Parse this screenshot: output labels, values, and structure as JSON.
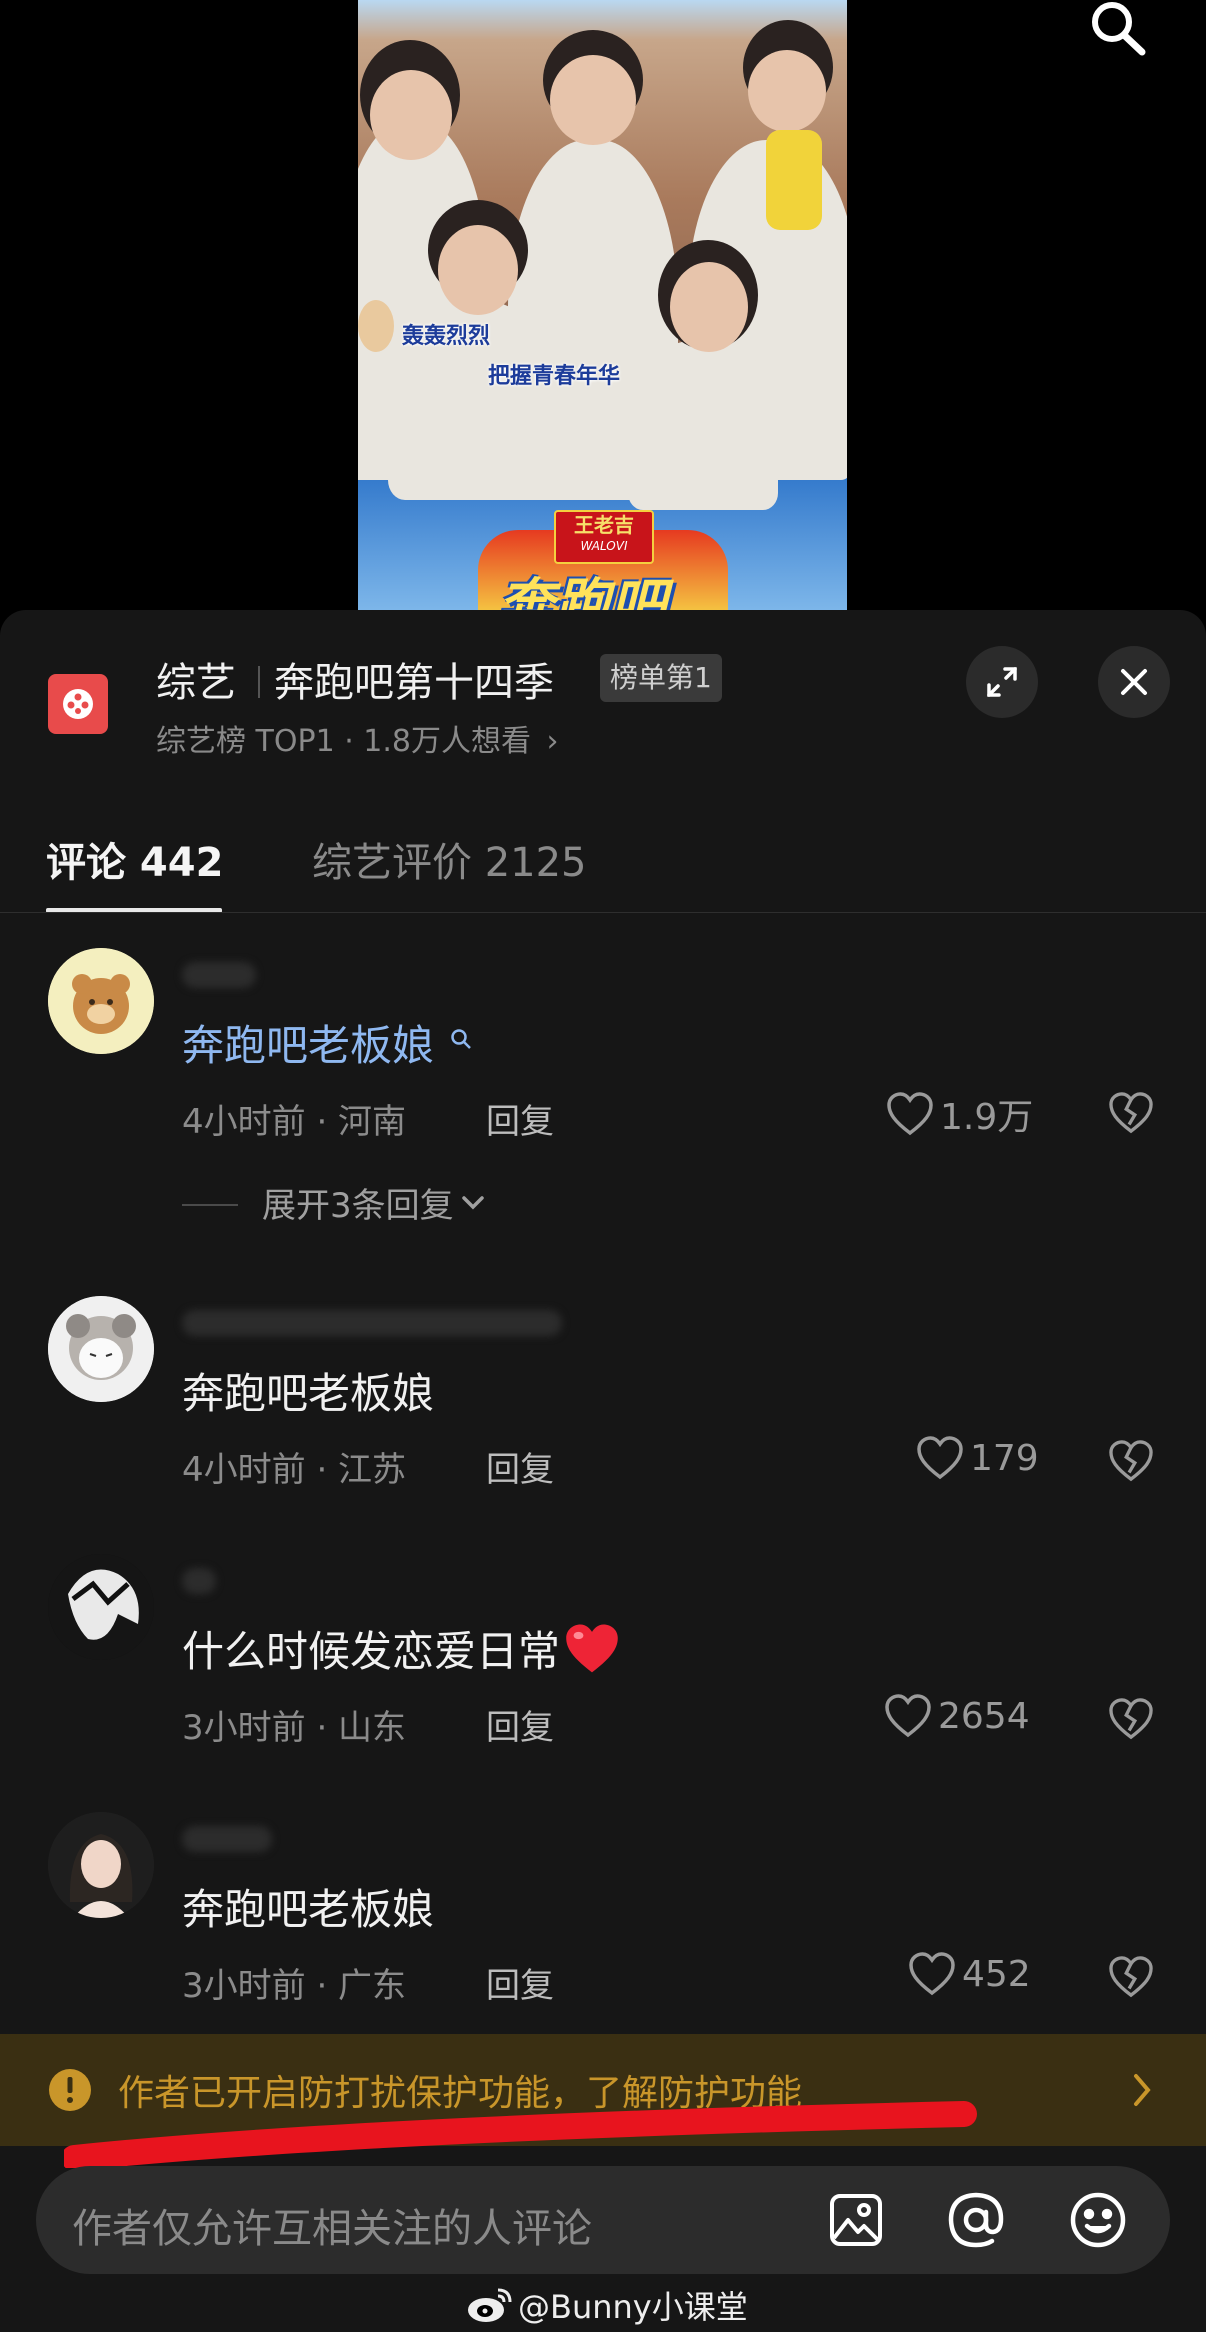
{
  "video": {
    "subtitle_1": "轰轰烈烈",
    "subtitle_2": "把握青春年华",
    "sponsor_badge": "王老吉",
    "sponsor_sub": "WALOVI",
    "show_logo_text": "奔跑吧"
  },
  "header": {
    "category": "综艺",
    "show_title": "奔跑吧第十四季",
    "rank_badge": "榜单第1",
    "sub_info": "综艺榜 TOP1 · 1.8万人想看",
    "chevron": "›"
  },
  "tabs": [
    {
      "label": "评论 442",
      "active": true
    },
    {
      "label": "综艺评价 2125",
      "active": false
    }
  ],
  "comments": [
    {
      "text": "奔跑吧老板娘",
      "meta": "4小时前 · 河南",
      "reply": "回复",
      "likes": "1.9万",
      "expand": "展开3条回复",
      "highlighted": true
    },
    {
      "text": "奔跑吧老板娘",
      "meta": "4小时前 · 江苏",
      "reply": "回复",
      "likes": "179"
    },
    {
      "text": "什么时候发恋爱日常",
      "meta": "3小时前 · 山东",
      "reply": "回复",
      "likes": "2654"
    },
    {
      "text": "奔跑吧老板娘",
      "meta": "3小时前 · 广东",
      "reply": "回复",
      "likes": "452"
    }
  ],
  "banner": {
    "text": "作者已开启防打扰保护功能，了解防护功能",
    "color": "#c9962a"
  },
  "input": {
    "placeholder": "作者仅允许互相关注的人评论"
  },
  "watermark": "@Bunny小课堂",
  "colors": {
    "accent_link": "#8fb8f0",
    "annotation_red": "#e8141e",
    "sheet_bg": "#161616"
  },
  "icons": [
    "search-icon",
    "app-icon",
    "expand-icon",
    "close-icon",
    "heart-icon",
    "dislike-heart-icon",
    "chevron-down-icon",
    "warning-icon",
    "chevron-right-icon",
    "image-icon",
    "at-icon",
    "emoji-icon",
    "weibo-icon"
  ]
}
